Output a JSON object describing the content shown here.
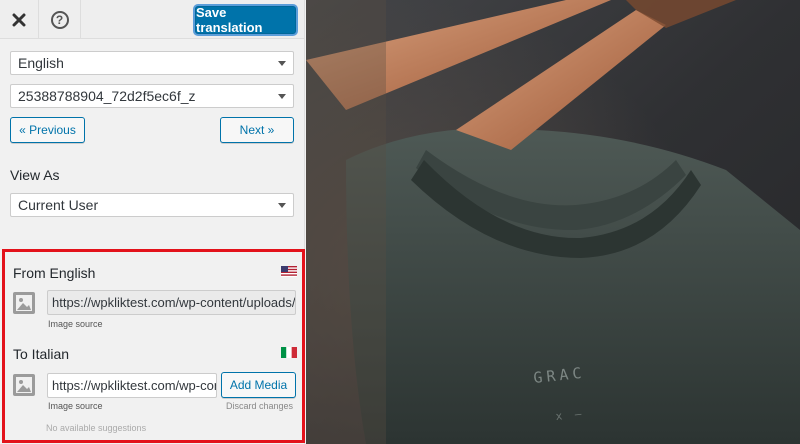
{
  "toolbar": {
    "save_label": "Save translation"
  },
  "selectors": {
    "language": "English",
    "string": "25388788904_72d2f5ec6f_z",
    "view_as_label": "View As",
    "view_as_value": "Current User"
  },
  "nav": {
    "previous": "« Previous",
    "next": "Next »"
  },
  "translation": {
    "from_label": "From English",
    "from_url": "https://wpkliktest.com/wp-content/uploads/2",
    "from_note": "Image source",
    "to_label": "To Italian",
    "to_url": "https://wpkliktest.com/wp-con",
    "to_note": "Image source",
    "add_media": "Add Media",
    "discard": "Discard changes",
    "suggestions": "No available suggestions"
  },
  "photo": {
    "shirt_text_1": "GRAC",
    "shirt_text_2": "x —"
  },
  "colors": {
    "accent": "#0073aa",
    "highlight_border": "#e3121b",
    "sidebar_bg": "#f1f1f1"
  },
  "icons": {
    "close": "close-icon",
    "help": "help-icon",
    "image": "image-placeholder-icon",
    "flag_from": "us-flag-icon",
    "flag_to": "italy-flag-icon"
  }
}
